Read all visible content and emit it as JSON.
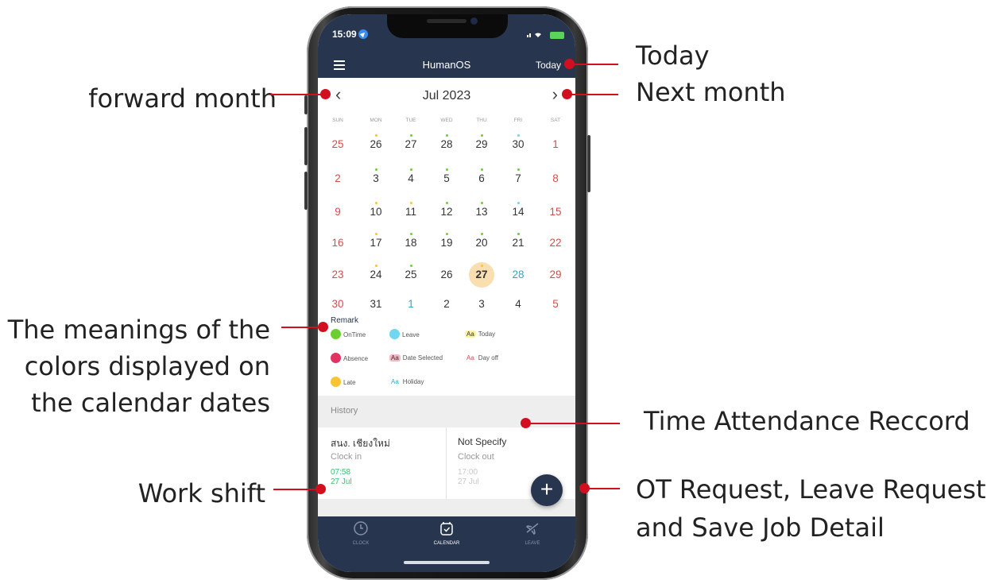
{
  "annotations": {
    "today": "Today",
    "next_month": "Next month",
    "forward_month": "forward month",
    "remark_lines": [
      "The meanings of the",
      "colors displayed on",
      "the calendar dates"
    ],
    "history": "Time Attendance Reccord",
    "work_shift": "Work shift",
    "fab_lines": [
      "OT Request, Leave Request",
      "and Save Job Detail"
    ]
  },
  "status_bar": {
    "time": "15:09"
  },
  "header": {
    "title": "HumanOS",
    "today_link": "Today"
  },
  "calendar": {
    "month_label": "Jul 2023",
    "weekdays": [
      "SUN",
      "MON",
      "TUE",
      "WED",
      "THU",
      "FRI",
      "SAT"
    ],
    "weeks": [
      [
        "25",
        "26",
        "27",
        "28",
        "29",
        "30",
        "1"
      ],
      [
        "2",
        "3",
        "4",
        "5",
        "6",
        "7",
        "8"
      ],
      [
        "9",
        "10",
        "11",
        "12",
        "13",
        "14",
        "15"
      ],
      [
        "16",
        "17",
        "18",
        "19",
        "20",
        "21",
        "22"
      ],
      [
        "23",
        "24",
        "25",
        "26",
        "27",
        "28",
        "29"
      ],
      [
        "30",
        "31",
        "1",
        "2",
        "3",
        "4",
        "5"
      ]
    ],
    "selected_today": "27"
  },
  "legend": {
    "title": "Remark",
    "ontime": "OnTime",
    "leave": "Leave",
    "today": "Today",
    "absence": "Absence",
    "date_selected": "Date Selected",
    "day_off": "Day off",
    "late": "Late",
    "holiday": "Holiday",
    "aa": "Aa",
    "colors": {
      "ontime": "#6bd02e",
      "leave": "#6fd7ef",
      "absence": "#e0335f",
      "late": "#f8c433",
      "today_bg": "#f9f3a8",
      "selected_bg": "#f6b8c3"
    }
  },
  "history": {
    "title": "History",
    "clock_in": {
      "location": "สนง. เชียงใหม่",
      "label": "Clock in",
      "time": "07:58",
      "date": "27 Jul"
    },
    "clock_out": {
      "location": "Not Specify",
      "label": "Clock out",
      "time": "17:00",
      "date": "27 Jul"
    }
  },
  "fab": {
    "label": "+"
  },
  "tabs": {
    "clock": "CLOCK",
    "calendar": "CALENDAR",
    "leave": "LEAVE"
  }
}
